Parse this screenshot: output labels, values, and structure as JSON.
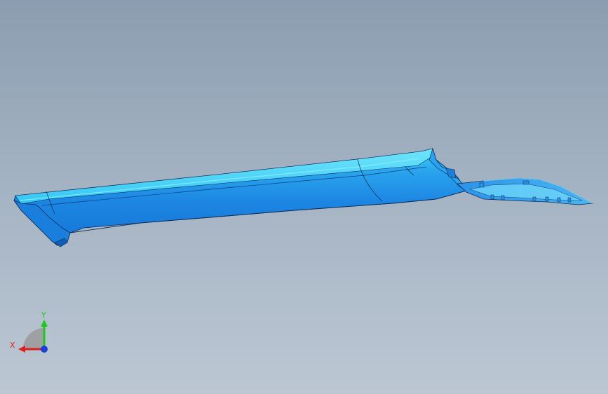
{
  "viewport": {
    "background_top": "#8c9db1",
    "background_bottom": "#bcc7d3",
    "model_color": "#1f8fe8",
    "model_highlight": "#3fd0f5",
    "edge_color": "#0a2a55"
  },
  "triad": {
    "x_label": "X",
    "y_label": "Y",
    "x_color": "#e0201c",
    "y_color": "#1ec81e",
    "z_color": "#1a3fd8"
  }
}
